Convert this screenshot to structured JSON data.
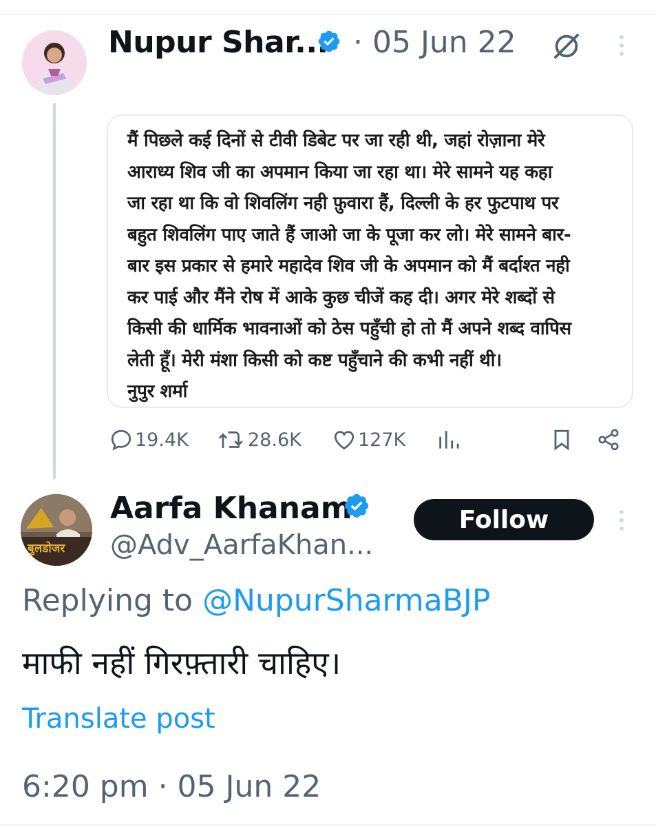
{
  "tweet1": {
    "author_name": "Nupur Shar...",
    "date": "· 05 Jun 22",
    "quote_lines": [
      "मैं पिछले कई दिनों से टीवी डिबेट पर जा रही थी, जहां रोज़ाना मेरे",
      "आराध्य शिव जी का अपमान किया जा रहा था। मेरे सामने यह कहा",
      "जा रहा था कि वो शिवलिंग नही फ़ुवारा हैं, दिल्ली के हर फुटपाथ पर",
      "बहुत शिवलिंग पाए जाते हैं जाओ जा के पूजा कर लो। मेरे सामने बार-",
      "बार इस प्रकार से हमारे महादेव शिव जी के अपमान को मैं बर्दाश्त नही",
      "कर पाई और मैंने रोष में आके कुछ चीजें कह दी। अगर मेरे शब्दों से",
      "किसी की धार्मिक भावनाओं को ठेस पहुँची हो तो मैं अपने शब्द वापिस",
      "लेती हूँ। मेरी मंशा किसी को कष्ट पहुँचाने की कभी नहीं थी।",
      "नुपुर शर्मा"
    ],
    "stats": {
      "replies": "19.4K",
      "reposts": "28.6K",
      "likes": "127K"
    }
  },
  "tweet2": {
    "author_name": "Aarfa Khanam",
    "handle": "@Adv_AarfaKhan...",
    "follow_label": "Follow",
    "avatar_text": "बुलडोजर",
    "replying_prefix": "Replying to",
    "replying_to": "@NupurSharmaBJP",
    "text": "माफी नहीं गिरफ़्तारी चाहिए।",
    "translate_label": "Translate post",
    "timestamp": "6:20 pm · 05 Jun 22"
  },
  "colors": {
    "verified": "#1d9bf0",
    "link": "#1d9bf0",
    "secondary_text": "#536471",
    "primary_text": "#0f1419",
    "follow_button_bg": "#0f1419"
  }
}
